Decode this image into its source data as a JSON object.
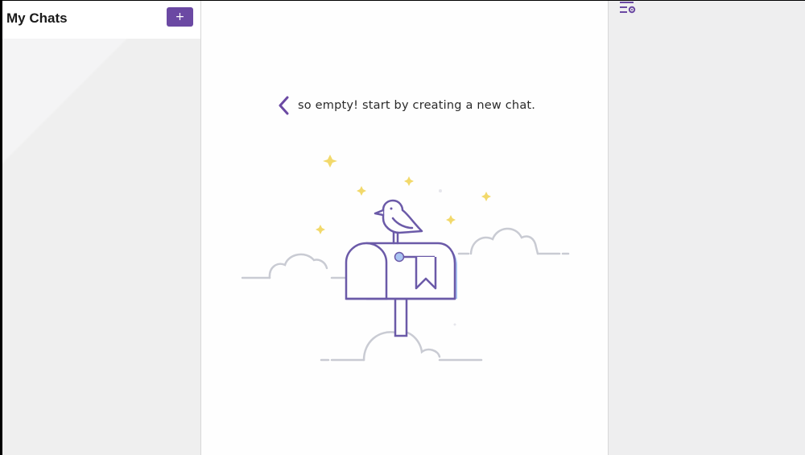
{
  "sidebar": {
    "title": "My Chats",
    "new_chat_label": "+"
  },
  "main": {
    "empty_message": "so empty! start by creating a new chat."
  },
  "icons": {
    "back": "chevron-left-icon",
    "settings": "settings-list-icon",
    "illustration": "mailbox-bird-illustration"
  },
  "colors": {
    "accent": "#6b49a3",
    "illustration_stroke": "#6b5aa8",
    "mailbox_highlight": "#a9c4f2",
    "cloud": "#c9cbd3",
    "star": "#f2d96b"
  }
}
